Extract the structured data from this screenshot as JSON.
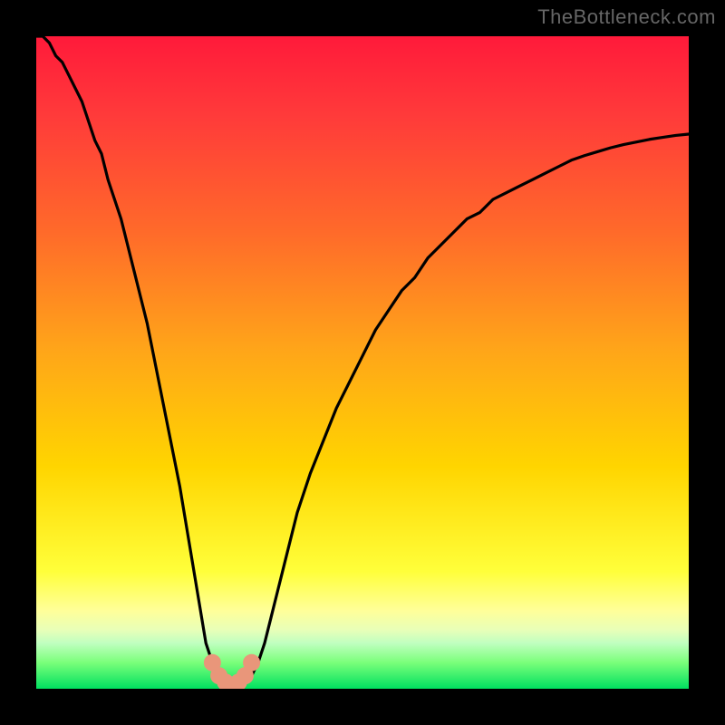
{
  "attribution": "TheBottleneck.com",
  "colors": {
    "frame": "#000000",
    "gradient_top": "#ff1a3a",
    "gradient_bottom": "#00e060",
    "marker_fill": "#e9967a",
    "marker_stroke": "#e9967a",
    "curve_stroke": "#000000"
  },
  "chart_data": {
    "type": "line",
    "title": "",
    "xlabel": "",
    "ylabel": "",
    "xlim": [
      0,
      100
    ],
    "ylim": [
      0,
      100
    ],
    "grid": false,
    "legend": false,
    "x": [
      0,
      1,
      2,
      3,
      4,
      5,
      6,
      7,
      8,
      9,
      10,
      11,
      12,
      13,
      14,
      15,
      16,
      17,
      18,
      19,
      20,
      21,
      22,
      23,
      24,
      25,
      26,
      27,
      28,
      29,
      30,
      31,
      32,
      33,
      34,
      35,
      36,
      37,
      38,
      39,
      40,
      42,
      44,
      46,
      48,
      50,
      52,
      54,
      56,
      58,
      60,
      62,
      64,
      66,
      68,
      70,
      72,
      74,
      76,
      78,
      80,
      82,
      84,
      86,
      88,
      90,
      92,
      94,
      96,
      98,
      100
    ],
    "values": [
      100,
      100,
      99,
      97,
      96,
      94,
      92,
      90,
      87,
      84,
      82,
      78,
      75,
      72,
      68,
      64,
      60,
      56,
      51,
      46,
      41,
      36,
      31,
      25,
      19,
      13,
      7,
      4,
      2,
      1,
      0,
      0,
      1,
      2,
      4,
      7,
      11,
      15,
      19,
      23,
      27,
      33,
      38,
      43,
      47,
      51,
      55,
      58,
      61,
      63,
      66,
      68,
      70,
      72,
      73,
      75,
      76,
      77,
      78,
      79,
      80,
      81,
      81.7,
      82.3,
      82.9,
      83.4,
      83.8,
      84.2,
      84.5,
      84.8,
      85
    ],
    "markers": {
      "x": [
        27,
        28,
        29,
        30,
        31,
        32,
        33
      ],
      "y": [
        4,
        2,
        1,
        0,
        1,
        2,
        4
      ]
    }
  }
}
